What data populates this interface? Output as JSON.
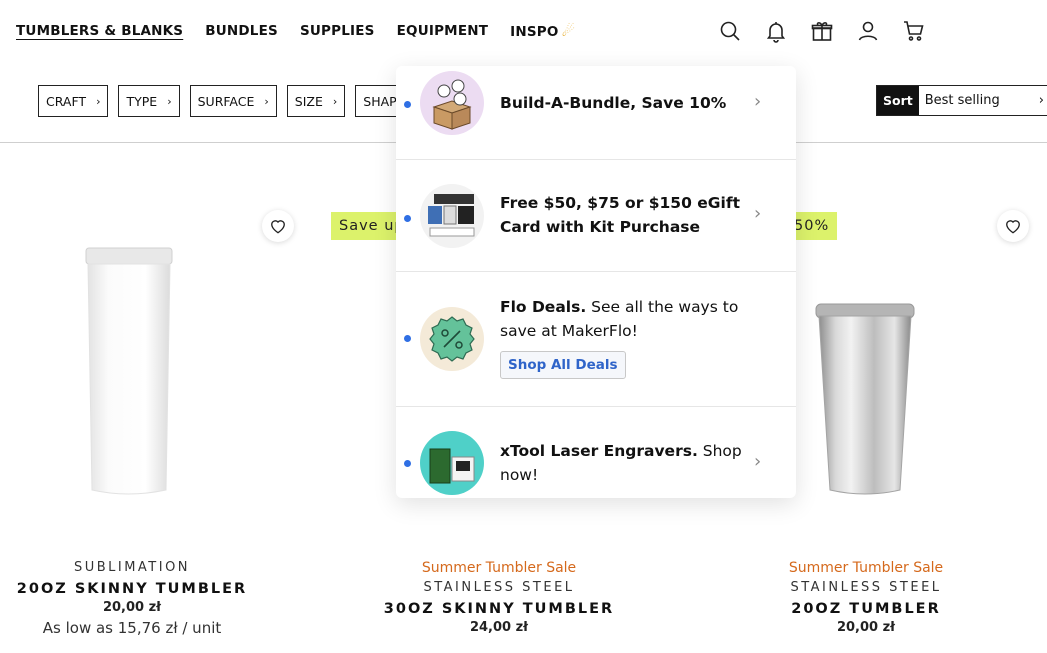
{
  "nav": {
    "links": [
      {
        "label": "TUMBLERS & BLANKS"
      },
      {
        "label": "BUNDLES"
      },
      {
        "label": "SUPPLIES"
      },
      {
        "label": "EQUIPMENT"
      },
      {
        "label": "INSPO"
      }
    ],
    "icons": [
      "search-icon",
      "bell-icon",
      "gift-icon",
      "account-icon",
      "cart-icon"
    ]
  },
  "filters": [
    {
      "label": "CRAFT"
    },
    {
      "label": "TYPE"
    },
    {
      "label": "SURFACE"
    },
    {
      "label": "SIZE"
    },
    {
      "label": "SHAPE"
    }
  ],
  "sort": {
    "label": "Sort",
    "value": "Best selling"
  },
  "dropdown": {
    "items": [
      {
        "bold": "Build-A-Bundle, Save 10%",
        "text": ""
      },
      {
        "bold": "Free $50, $75 or $150 eGift Card with Kit Purchase",
        "text": ""
      },
      {
        "bold": "Flo Deals.",
        "text": " See all the ways to save at MakerFlo!",
        "button": "Shop All Deals"
      },
      {
        "bold": "xTool Laser Engravers.",
        "text": " Shop now!"
      }
    ]
  },
  "products": [
    {
      "badge": "",
      "sale": "",
      "category": "SUBLIMATION",
      "name": "20OZ SKINNY TUMBLER",
      "price": "20,00 zł",
      "low": "As low as 15,76 zł / unit"
    },
    {
      "badge": "Save up",
      "sale": "Summer Tumbler Sale",
      "category": "STAINLESS STEEL",
      "name": "30OZ SKINNY TUMBLER",
      "price": "24,00 zł",
      "low": ""
    },
    {
      "badge": "50%",
      "sale": "Summer Tumbler Sale",
      "category": "STAINLESS STEEL",
      "name": "20OZ TUMBLER",
      "price": "20,00 zł",
      "low": ""
    }
  ],
  "colors": {
    "accent_blue": "#2f6fe4",
    "sale_orange": "#d5691c",
    "badge_green": "#dcf26b"
  }
}
